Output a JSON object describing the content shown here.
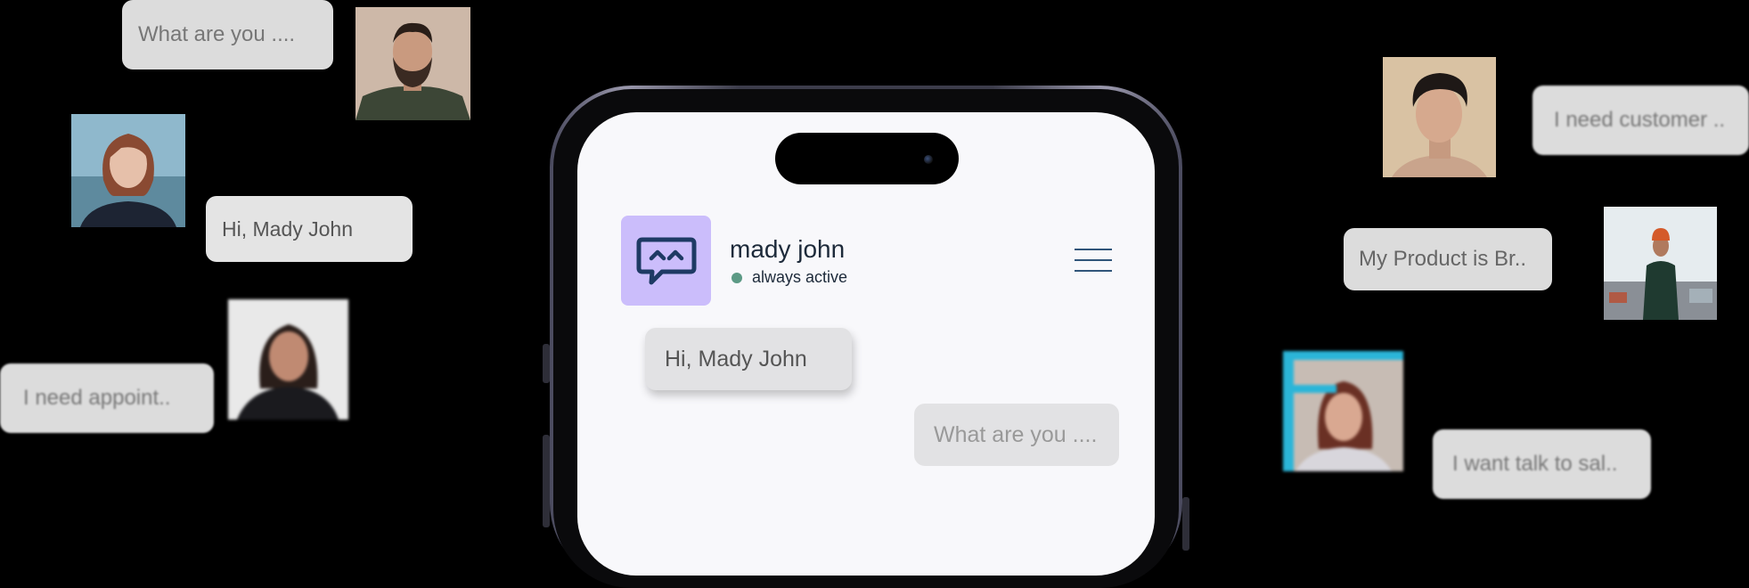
{
  "floating_bubbles": [
    {
      "id": "b1",
      "text": "What are you ...."
    },
    {
      "id": "b2",
      "text": "Hi, Mady John"
    },
    {
      "id": "b3",
      "text": "I need appoint.."
    },
    {
      "id": "b4",
      "text": "I need customer .."
    },
    {
      "id": "b5",
      "text": "My Product is Br.."
    },
    {
      "id": "b6",
      "text": "I want talk to sal.."
    }
  ],
  "chat": {
    "contact_name": "mady john",
    "status": "always active",
    "messages": [
      {
        "direction": "incoming",
        "text": "Hi, Mady John"
      },
      {
        "direction": "outgoing",
        "text": "What are you ...."
      }
    ]
  },
  "icons": {
    "logo": "chat-bubble-smile-icon",
    "menu": "hamburger-menu-icon",
    "status": "online-dot-icon"
  },
  "colors": {
    "logo_bg": "#cbbdfb",
    "logo_icon": "#1e3a64",
    "status_dot": "#5c9a85",
    "bubble_bg": "#dcdcdc",
    "menu_lines": "#30557a"
  }
}
